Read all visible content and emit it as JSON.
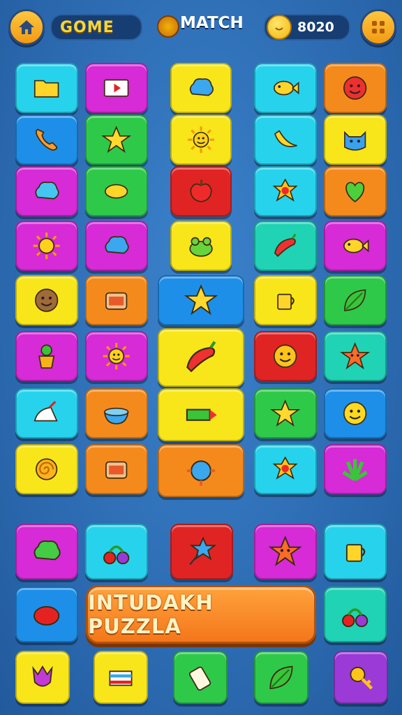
{
  "header": {
    "home_icon": "home-icon",
    "title": "GOME",
    "match_label": "MATCH",
    "score": "8020",
    "menu_icon": "grid-menu-icon"
  },
  "colors": {
    "cyan": "#27d3ec",
    "magenta": "#d62bd6",
    "yellow": "#f8e61a",
    "orange": "#f58a1c",
    "green": "#2fc94a",
    "blue": "#1e8fe8",
    "red": "#e02424",
    "teal": "#20d3b4",
    "purple": "#9b3ad6"
  },
  "board": {
    "tiles": [
      {
        "icon": "folder-icon",
        "color": "cyan"
      },
      {
        "icon": "video-icon",
        "color": "magenta"
      },
      {
        "icon": "blob-icon",
        "color": "yellow"
      },
      {
        "icon": "bird-icon",
        "color": "cyan"
      },
      {
        "icon": "red-face-icon",
        "color": "orange"
      },
      {
        "icon": "phone-icon",
        "color": "blue"
      },
      {
        "icon": "star-icon",
        "color": "green"
      },
      {
        "icon": "sun-face-icon",
        "color": "yellow"
      },
      {
        "icon": "banana-icon",
        "color": "cyan"
      },
      {
        "icon": "cat-face-icon",
        "color": "yellow"
      },
      {
        "icon": "cloud-icon",
        "color": "magenta"
      },
      {
        "icon": "lemon-icon",
        "color": "green"
      },
      {
        "icon": "apple-icon",
        "color": "red"
      },
      {
        "icon": "badge-icon",
        "color": "cyan"
      },
      {
        "icon": "heart-icon",
        "color": "orange"
      },
      {
        "icon": "sun-icon",
        "color": "magenta"
      },
      {
        "icon": "blob-icon",
        "color": "magenta"
      },
      {
        "icon": "frog-icon",
        "color": "yellow"
      },
      {
        "icon": "pepper-icon",
        "color": "teal"
      },
      {
        "icon": "fish-icon",
        "color": "magenta"
      },
      {
        "icon": "cookie-face-icon",
        "color": "yellow"
      },
      {
        "icon": "basket-icon",
        "color": "orange"
      },
      {
        "icon": "stars-icon",
        "color": "blue",
        "wide": true
      },
      {
        "icon": "cup-icon",
        "color": "yellow"
      },
      {
        "icon": "leaf-icon",
        "color": "green"
      },
      {
        "icon": "plant-pot-icon",
        "color": "magenta"
      },
      {
        "icon": "sun-face-icon",
        "color": "magenta"
      },
      {
        "icon": "chili-icon",
        "color": "yellow",
        "wide": true
      },
      {
        "icon": "smile-mask-icon",
        "color": "red"
      },
      {
        "icon": "star-face-icon",
        "color": "teal"
      },
      {
        "icon": "iron-icon",
        "color": "cyan"
      },
      {
        "icon": "bowl-icon",
        "color": "orange"
      },
      {
        "icon": "crayon-icon",
        "color": "yellow",
        "wide": true
      },
      {
        "icon": "star-icon",
        "color": "green"
      },
      {
        "icon": "smiley-icon",
        "color": "blue"
      },
      {
        "icon": "spiral-icon",
        "color": "yellow"
      },
      {
        "icon": "radio-icon",
        "color": "orange"
      },
      {
        "icon": "bug-icon",
        "color": "orange",
        "wide": true
      },
      {
        "icon": "lion-icon",
        "color": "cyan"
      },
      {
        "icon": "leaf-bunch-icon",
        "color": "magenta"
      }
    ]
  },
  "tray": {
    "tiles": [
      {
        "icon": "green-blob-icon",
        "color": "magenta"
      },
      {
        "icon": "fruits-icon",
        "color": "cyan"
      },
      {
        "icon": "star-lollipop-icon",
        "color": "red"
      },
      {
        "icon": "star-face-icon",
        "color": "magenta"
      },
      {
        "icon": "cup-icon",
        "color": "cyan"
      },
      {
        "icon": "red-bean-icon",
        "color": "blue"
      },
      {
        "icon": "fruits-icon",
        "color": "teal"
      },
      {
        "icon": "tulip-icon",
        "color": "yellow"
      },
      {
        "icon": "flag-icon",
        "color": "yellow"
      },
      {
        "icon": "roll-icon",
        "color": "green"
      },
      {
        "icon": "leaf-icon",
        "color": "green"
      },
      {
        "icon": "key-icon",
        "color": "purple"
      }
    ],
    "cta_label": "INTUDAKH PUZZLA"
  }
}
